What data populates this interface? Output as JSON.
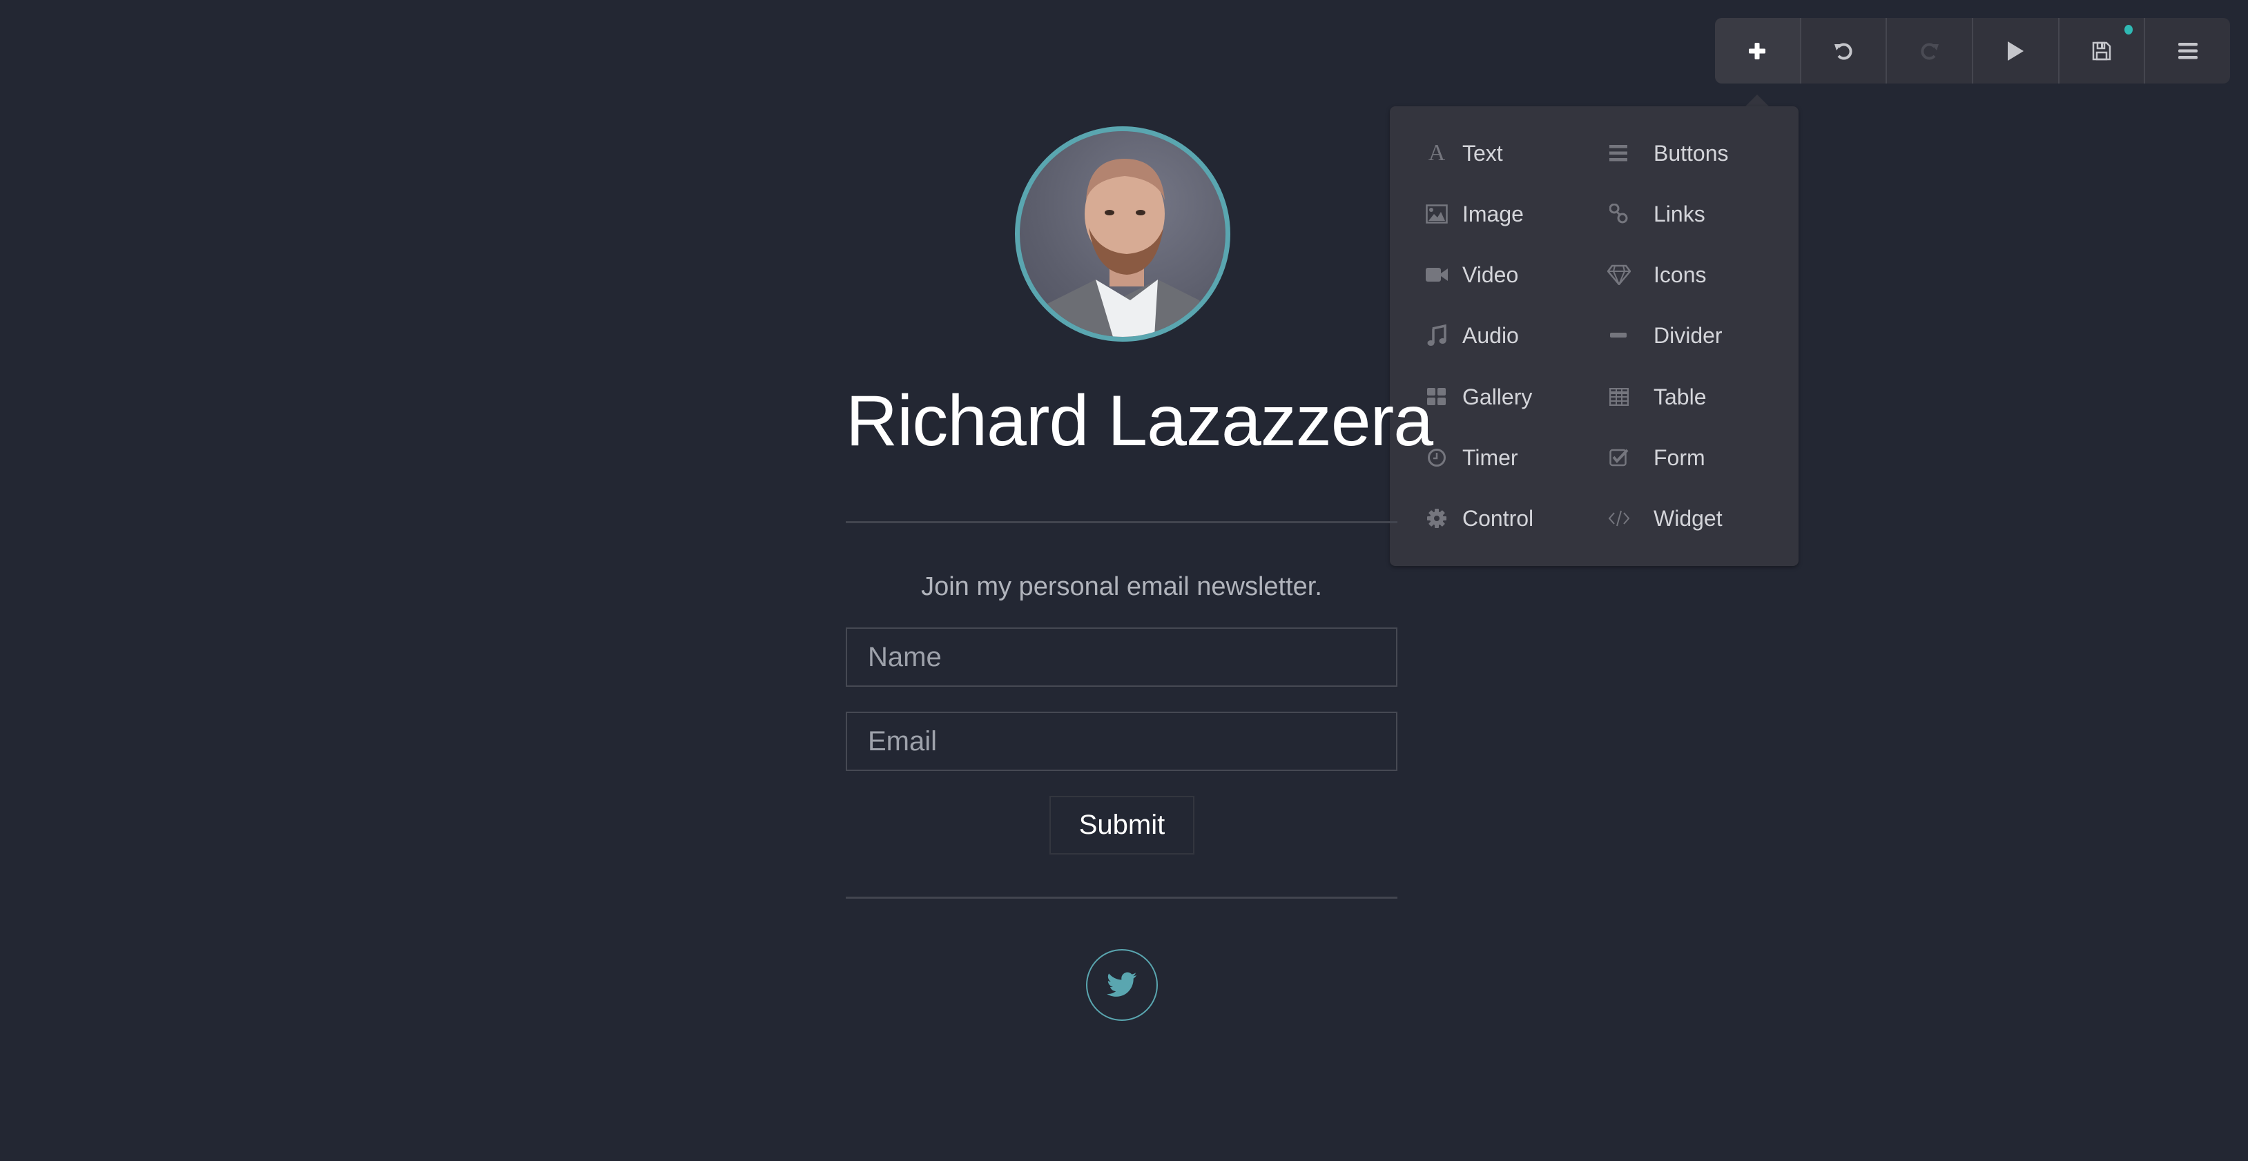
{
  "toolbar": {
    "buttons": [
      {
        "name": "add",
        "icon": "plus-icon",
        "state": "active"
      },
      {
        "name": "undo",
        "icon": "undo-icon",
        "state": "enabled"
      },
      {
        "name": "redo",
        "icon": "redo-icon",
        "state": "disabled"
      },
      {
        "name": "preview",
        "icon": "play-icon",
        "state": "enabled"
      },
      {
        "name": "save",
        "icon": "save-icon",
        "state": "enabled",
        "badge": "unsaved-changes-dot"
      },
      {
        "name": "menu",
        "icon": "hamburger-menu-icon",
        "state": "enabled"
      }
    ],
    "badge_color": "#2fb9b4"
  },
  "add_menu": {
    "left_column": [
      {
        "label": "Text",
        "icon": "serif-a-icon"
      },
      {
        "label": "Image",
        "icon": "image-icon"
      },
      {
        "label": "Video",
        "icon": "video-camera-icon"
      },
      {
        "label": "Audio",
        "icon": "music-note-icon"
      },
      {
        "label": "Gallery",
        "icon": "grid-icon"
      },
      {
        "label": "Timer",
        "icon": "clock-icon"
      },
      {
        "label": "Control",
        "icon": "gear-icon"
      }
    ],
    "right_column": [
      {
        "label": "Buttons",
        "icon": "bars-icon"
      },
      {
        "label": "Links",
        "icon": "chain-link-icon"
      },
      {
        "label": "Icons",
        "icon": "diamond-icon"
      },
      {
        "label": "Divider",
        "icon": "minus-icon"
      },
      {
        "label": "Table",
        "icon": "table-icon"
      },
      {
        "label": "Form",
        "icon": "checkbox-icon"
      },
      {
        "label": "Widget",
        "icon": "code-icon"
      }
    ]
  },
  "page": {
    "avatar_alt": "Profile photo",
    "heading": "Richard Lazazzera",
    "subtitle": "Join my personal email newsletter.",
    "form": {
      "name_placeholder": "Name",
      "name_value": "",
      "email_placeholder": "Email",
      "email_value": "",
      "submit_label": "Submit"
    },
    "social": [
      {
        "network": "Twitter",
        "icon": "twitter-icon"
      }
    ],
    "accent_color": "#5aa6b0"
  }
}
